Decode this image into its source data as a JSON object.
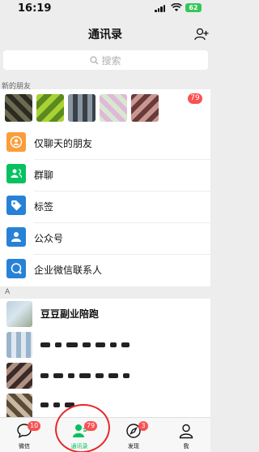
{
  "status": {
    "time": "16:19",
    "battery": "62"
  },
  "header": {
    "title": "通讯录"
  },
  "search": {
    "placeholder": "搜索"
  },
  "new_friends": {
    "label": "新的朋友",
    "badge": "79",
    "avatar_colors": [
      "#3a3a2e",
      "#9ac43a",
      "#7d8a96",
      "#c8d8c8",
      "#5a3a3a"
    ]
  },
  "functions": [
    {
      "label": "仅聊天的朋友",
      "icon": "person-chat-icon",
      "color": "#fa9d3b"
    },
    {
      "label": "群聊",
      "icon": "group-icon",
      "color": "#07c160"
    },
    {
      "label": "标签",
      "icon": "tag-icon",
      "color": "#2782d7"
    },
    {
      "label": "公众号",
      "icon": "official-account-icon",
      "color": "#2782d7"
    },
    {
      "label": "企业微信联系人",
      "icon": "work-chat-icon",
      "color": "#2782d7"
    }
  ],
  "section": {
    "letter": "A"
  },
  "contacts": [
    {
      "name": "豆豆副业陪跑"
    }
  ],
  "tabs": [
    {
      "label": "微信",
      "badge": "10",
      "icon": "chat-bubble-icon"
    },
    {
      "label": "通讯录",
      "badge": "79",
      "icon": "contacts-icon"
    },
    {
      "label": "发现",
      "badge": "3",
      "icon": "compass-icon"
    },
    {
      "label": "我",
      "badge": "",
      "icon": "person-icon"
    }
  ],
  "colors": {
    "accent": "#07c160",
    "badge": "#fa5151",
    "annotation": "#e8262b"
  }
}
